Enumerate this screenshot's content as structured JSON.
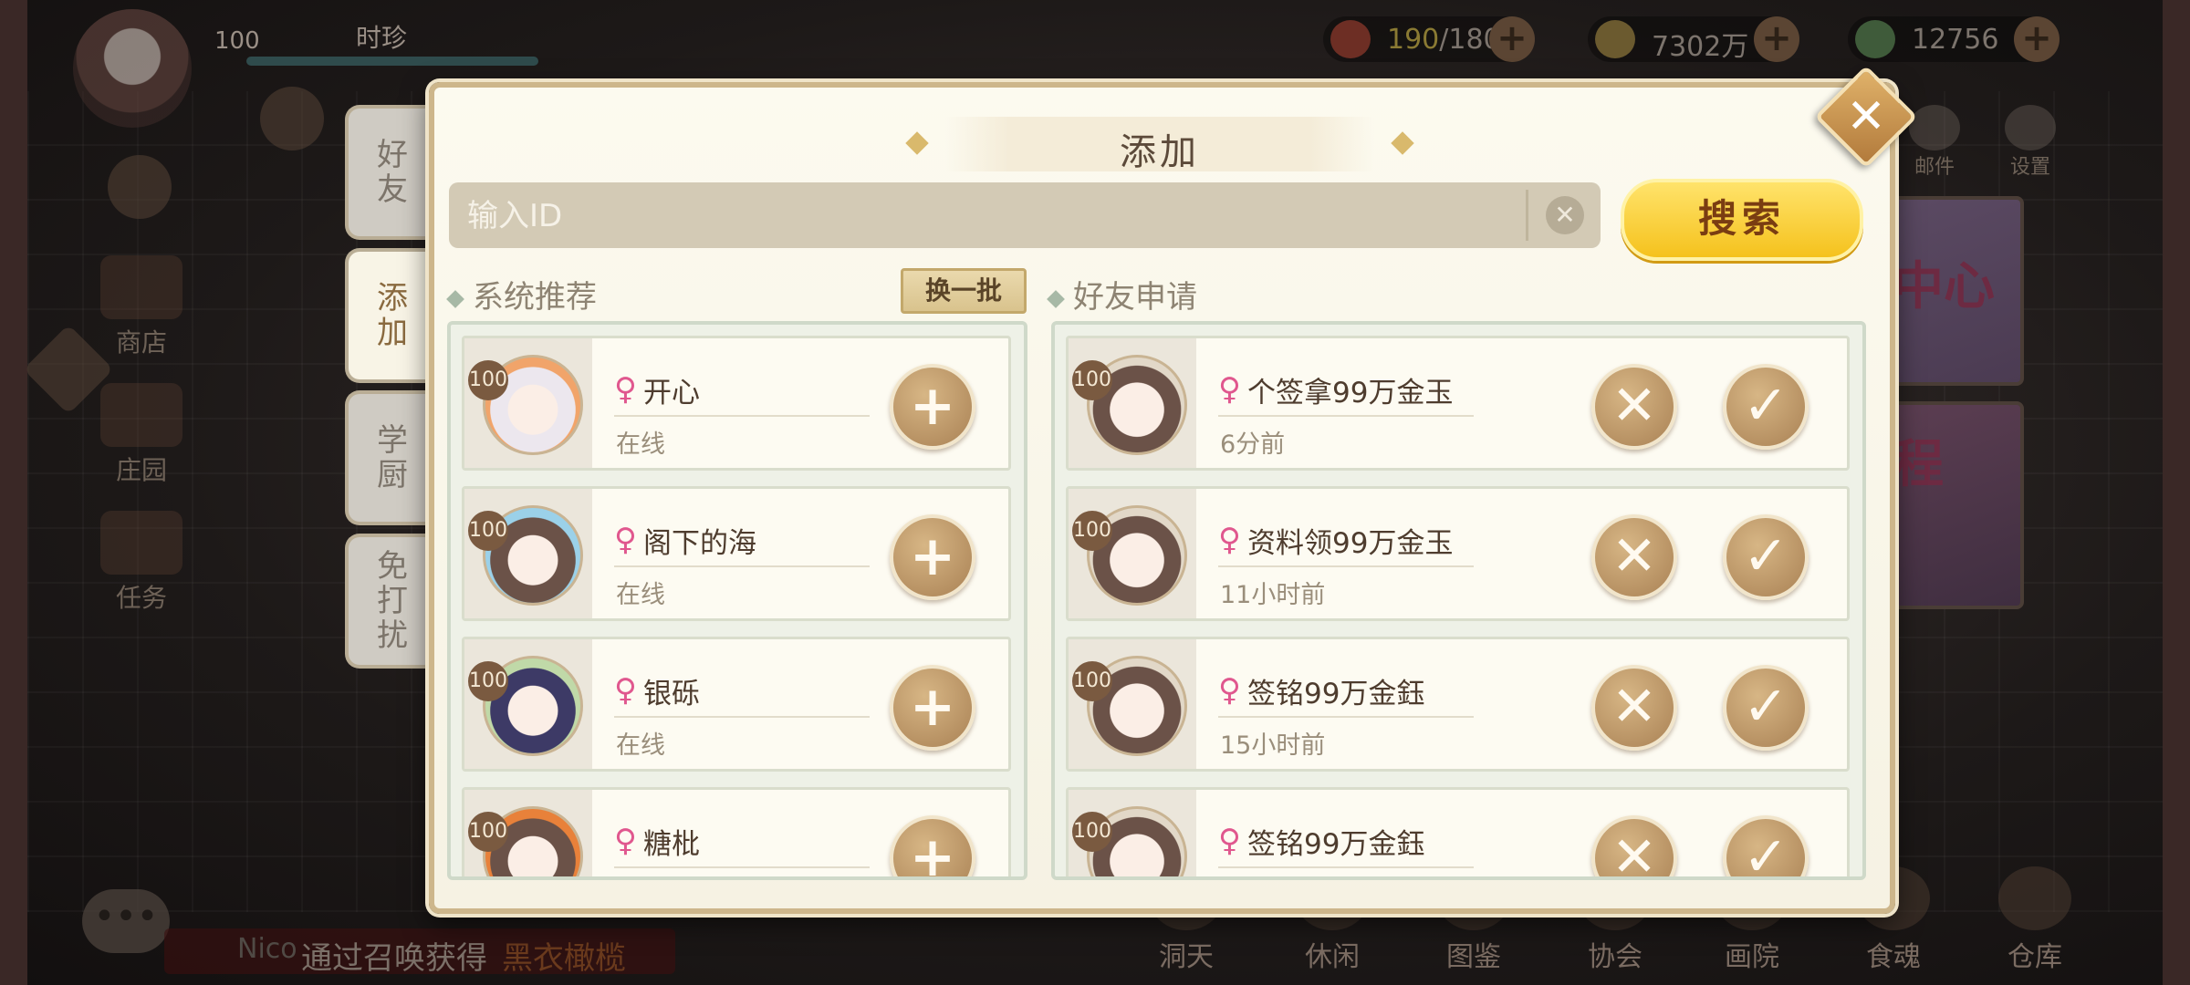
{
  "hud": {
    "player_level": "100",
    "player_name": "时珍",
    "stamina_current": "190",
    "stamina_max": "/180",
    "coins": "7302万",
    "jade": "12756"
  },
  "left_menu": [
    "商店",
    "庄园",
    "任务"
  ],
  "top_right_menu": [
    "邮件",
    "设置"
  ],
  "banners": [
    "中心",
    "程"
  ],
  "bottom_nav": [
    "洞天",
    "休闲",
    "图鉴",
    "协会",
    "画院",
    "食魂",
    "仓库"
  ],
  "ticker": {
    "prefix": "Nico",
    "text": "通过召唤获得",
    "highlight": "黑衣橄榄"
  },
  "tabs": [
    "好友",
    "添加",
    "学厨",
    "免打扰"
  ],
  "dialog": {
    "title": "添加",
    "close": "✕",
    "search_placeholder": "输入ID",
    "clear": "✕",
    "search_button": "搜索",
    "recommend_title": "系统推荐",
    "refresh_button": "换一批",
    "requests_title": "好友申请"
  },
  "recommendations": [
    {
      "level": "100",
      "name": "开心",
      "status": "在线"
    },
    {
      "level": "100",
      "name": "阁下的海",
      "status": "在线"
    },
    {
      "level": "100",
      "name": "银砾",
      "status": "在线"
    },
    {
      "level": "100",
      "name": "糖枇",
      "status": ""
    }
  ],
  "requests": [
    {
      "level": "100",
      "name": "个签拿99万金玉",
      "time": "6分前"
    },
    {
      "level": "100",
      "name": "资料领99万金玉",
      "time": "11小时前"
    },
    {
      "level": "100",
      "name": "签铭99万金鈺",
      "time": "15小时前"
    },
    {
      "level": "100",
      "name": "签铭99万金鈺",
      "time": ""
    }
  ],
  "icons": {
    "gender": "♀",
    "add": "+",
    "reject": "✕",
    "accept": "✓"
  },
  "colors": {
    "accent_gold": "#f5c21d",
    "female": "#e0578e",
    "button_brown": "#a98154"
  }
}
